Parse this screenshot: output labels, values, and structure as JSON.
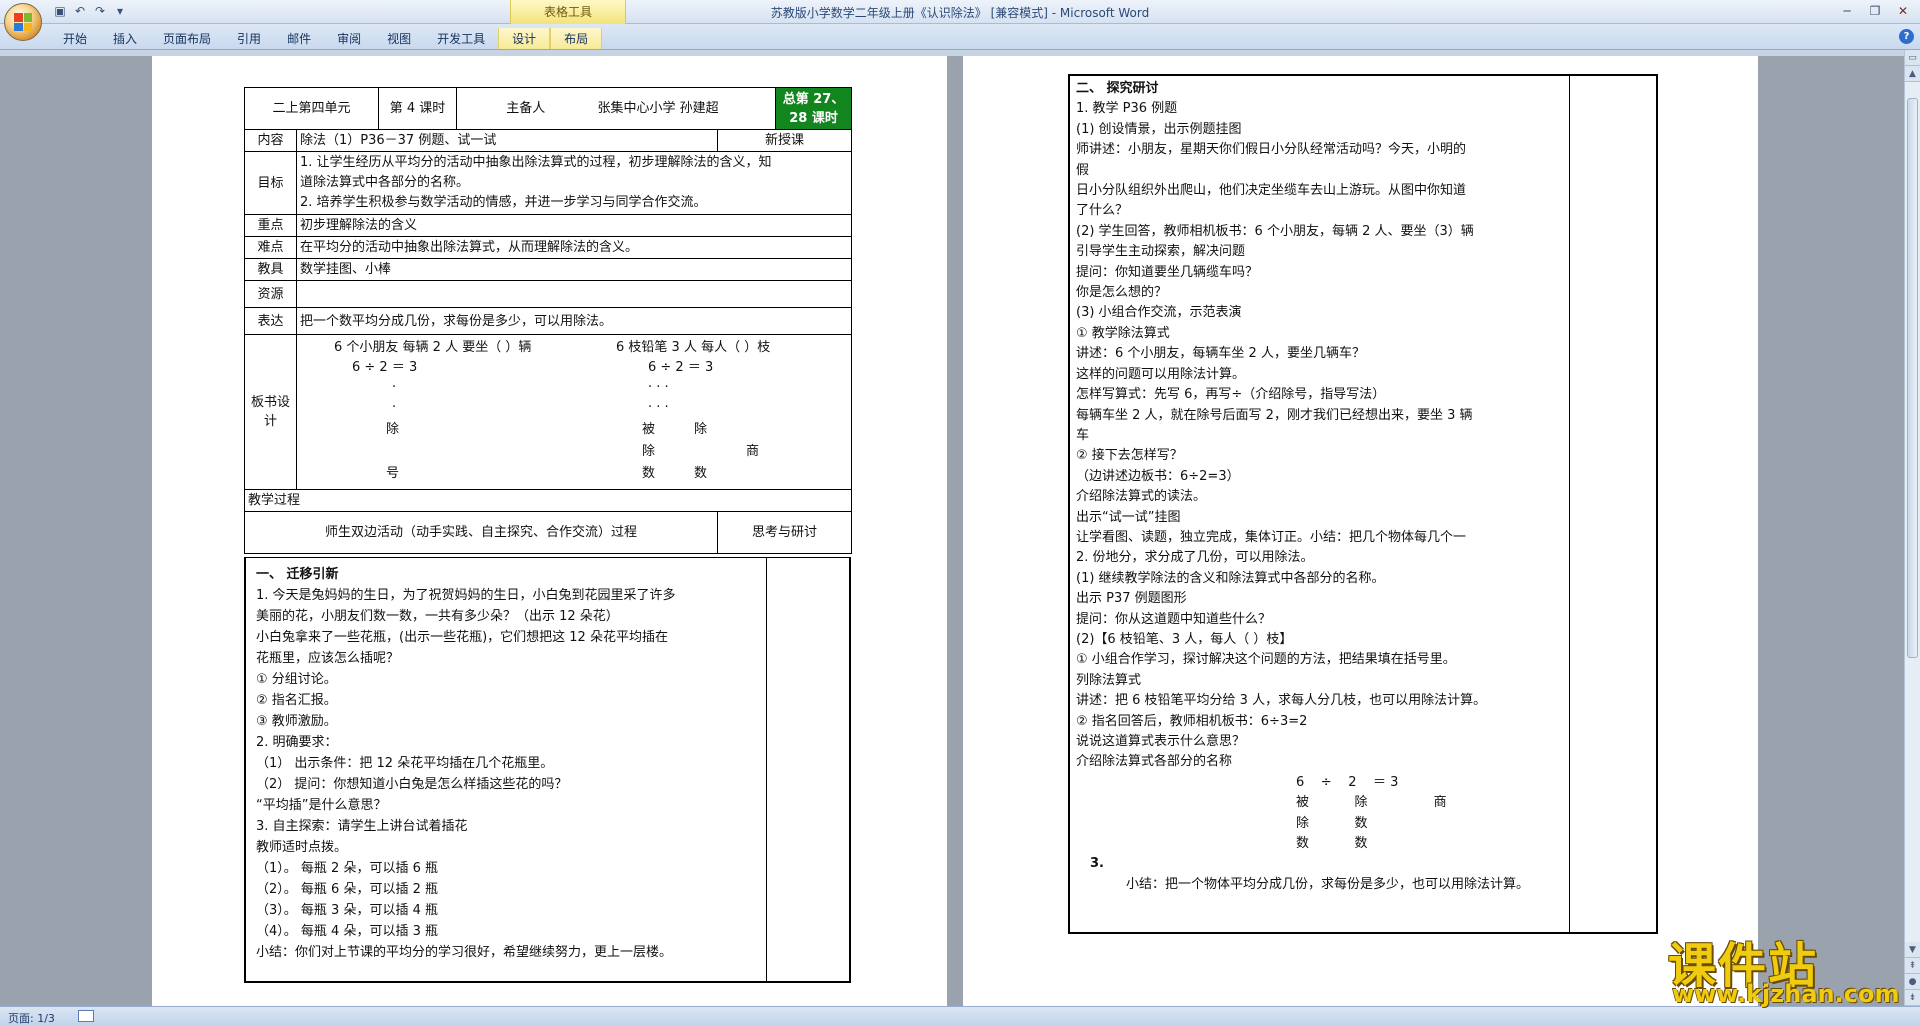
{
  "window": {
    "title": "苏教版小学数学二年级上册《认识除法》 [兼容模式] - Microsoft Word",
    "contextual_group": "表格工具",
    "controls": [
      "minimize",
      "restore",
      "close"
    ]
  },
  "ribbon": {
    "tabs": [
      "开始",
      "插入",
      "页面布局",
      "引用",
      "邮件",
      "审阅",
      "视图",
      "开发工具",
      "设计",
      "布局"
    ]
  },
  "page1": {
    "header": {
      "unit": "二上第四单元",
      "lesson": "第 4 课时",
      "preparer_label": "主备人",
      "preparer": "张集中心小学   孙建超",
      "total": "总第 27、28 课时"
    },
    "content": {
      "label": "内容",
      "value": "除法（1）P36－37 例题、试一试",
      "type": "新授课"
    },
    "goals": {
      "label": "目标",
      "items": [
        "1.   让学生经历从平均分的活动中抽象出除法算式的过程，初步理解除法的含义，知",
        "      道除法算式中各部分的名称。",
        "2.   培养学生积极参与数学活动的情感，并进一步学习与同学合作交流。"
      ]
    },
    "key": {
      "label": "重点",
      "value": "初步理解除法的含义"
    },
    "difficulty": {
      "label": "难点",
      "value": "在平均分的活动中抽象出除法算式，从而理解除法的含义。"
    },
    "tools": {
      "label": "教具",
      "value": "数学挂图、小棒"
    },
    "resources": {
      "label": "资源",
      "value": ""
    },
    "expression": {
      "label": "表达",
      "value": "把一个数平均分成几份，求每份是多少，可以用除法。"
    },
    "board": {
      "label": "板书设计",
      "left_title": "6 个小朋友    每辆 2 人  要坐（  ）辆",
      "left_eq": "6    ÷    2    ＝ 3",
      "left_dot": "·",
      "left_name_1": "除",
      "left_name_2": "号",
      "right_title": "6 枝铅笔    3 人  每人（    ）枝",
      "right_eq": "6    ÷    2    ＝ 3",
      "right_names": [
        "被",
        "除",
        "数",
        "除",
        "数",
        "商"
      ]
    },
    "process": {
      "label": "教学过程",
      "col_main": "师生双边活动（动手实践、自主探究、合作交流）过程",
      "col_side": "思考与研讨",
      "lines": [
        {
          "t": "一、 迁移引新",
          "cls": "b"
        },
        {
          "t": "  1.   今天是兔妈妈的生日，为了祝贺妈妈的生日，小白兔到花园里采了许多",
          "cls": ""
        },
        {
          "t": "         美丽的花，小朋友们数一数，一共有多少朵？（出示 12 朵花）",
          "cls": ""
        },
        {
          "t": "         小白兔拿来了一些花瓶，(出示一些花瓶)，它们想把这 12 朵花平均插在",
          "cls": ""
        },
        {
          "t": "         花瓶里，应该怎么插呢？",
          "cls": ""
        },
        {
          "t": "  ①    分组讨论。",
          "cls": ""
        },
        {
          "t": "  ②    指名汇报。",
          "cls": ""
        },
        {
          "t": "  ③    教师激励。",
          "cls": ""
        },
        {
          "t": "  2.   明确要求：",
          "cls": ""
        },
        {
          "t": "（1） 出示条件：把 12 朵花平均插在几个花瓶里。",
          "cls": ""
        },
        {
          "t": "（2） 提问：你想知道小白兔是怎么样插这些花的吗？",
          "cls": ""
        },
        {
          "t": "         “平均插”是什么意思？",
          "cls": ""
        },
        {
          "t": "  3.   自主探索：请学生上讲台试着插花",
          "cls": ""
        },
        {
          "t": "          教师适时点拨。",
          "cls": ""
        },
        {
          "t": "（1）。 每瓶 2 朵，可以插 6 瓶",
          "cls": ""
        },
        {
          "t": "（2）。 每瓶 6 朵，可以插 2 瓶",
          "cls": ""
        },
        {
          "t": "（3）。 每瓶 3 朵，可以插 4 瓶",
          "cls": ""
        },
        {
          "t": "（4）。 每瓶 4 朵，可以插 3 瓶",
          "cls": ""
        },
        {
          "t": "         小结：你们对上节课的平均分的学习很好，希望继续努力，更上一层楼。",
          "cls": ""
        }
      ]
    }
  },
  "page2": {
    "lines": [
      {
        "t": "二、 探究研讨",
        "cls": "b"
      },
      {
        "t": "  1.  教学 P36 例题",
        "cls": ""
      },
      {
        "t": "(1)  创设情景，出示例题挂图",
        "cls": ""
      },
      {
        "t": "        师讲述：小朋友，星期天你们假日小分队经常活动吗？今天，小明的",
        "cls": ""
      },
      {
        "t": "        假",
        "cls": ""
      },
      {
        "t": "        日小分队组织外出爬山，他们决定坐缆车去山上游玩。从图中你知道",
        "cls": ""
      },
      {
        "t": "        了什么？",
        "cls": ""
      },
      {
        "t": "(2)  学生回答，教师相机板书：6 个小朋友，每辆 2 人、要坐（3）辆",
        "cls": ""
      },
      {
        "t": "        引导学生主动探索，解决问题",
        "cls": ""
      },
      {
        "t": "        提问：你知道要坐几辆缆车吗？",
        "cls": ""
      },
      {
        "t": "        你是怎么想的？",
        "cls": ""
      },
      {
        "t": "(3)  小组合作交流，示范表演",
        "cls": ""
      },
      {
        "t": "   ①  教学除法算式",
        "cls": ""
      },
      {
        "t": "        讲述：6 个小朋友，每辆车坐 2 人，要坐几辆车？",
        "cls": ""
      },
      {
        "t": "        这样的问题可以用除法计算。",
        "cls": ""
      },
      {
        "t": "        怎样写算式：先写 6，再写÷（介绍除号，指导写法）",
        "cls": ""
      },
      {
        "t": "        每辆车坐 2 人，就在除号后面写 2，刚才我们已经想出来，要坐 3 辆",
        "cls": ""
      },
      {
        "t": "        车",
        "cls": ""
      },
      {
        "t": "   ②  接下去怎样写？",
        "cls": ""
      },
      {
        "t": "        （边讲述边板书：6÷2=3）",
        "cls": ""
      },
      {
        "t": "        介绍除法算式的读法。",
        "cls": ""
      },
      {
        "t": "        出示“试一试”挂图",
        "cls": ""
      },
      {
        "t": "        让学看图、读题，独立完成，集体订正。小结：把几个物体每几个一",
        "cls": ""
      },
      {
        "t": "  2.  份地分，求分成了几份，可以用除法。",
        "cls": ""
      },
      {
        "t": "(1)  继续教学除法的含义和除法算式中各部分的名称。",
        "cls": ""
      },
      {
        "t": "        出示 P37 例题图形",
        "cls": ""
      },
      {
        "t": "         提问：你从这道题中知道些什么？",
        "cls": ""
      },
      {
        "t": "(2)【6 枝铅笔、3 人，每人（   ）枝】",
        "cls": ""
      },
      {
        "t": "   ①  小组合作学习，探讨解决这个问题的方法，把结果填在括号里。",
        "cls": ""
      },
      {
        "t": "        列除法算式",
        "cls": ""
      },
      {
        "t": "        讲述：把 6 枝铅笔平均分给 3 人，求每人分几枝，也可以用除法计算。",
        "cls": ""
      },
      {
        "t": "   ②  指名回答后，教师相机板书：6÷3=2",
        "cls": ""
      },
      {
        "t": "        说说这道算式表示什么意思？",
        "cls": ""
      },
      {
        "t": "        介绍除法算式各部分的名称",
        "cls": ""
      }
    ],
    "eq_line": "6    ÷    2    ＝ 3",
    "name_row_1": "被           除                商",
    "name_row_2": "除           数",
    "name_row_3": "数           数",
    "step3": "3.",
    "summary": "小结：把一个物体平均分成几份，求每份是多少，也可以用除法计算。"
  },
  "statusbar": {
    "page": "页面: 1/3"
  },
  "watermark": {
    "cn": "课件站",
    "url": "www.kjzhan.com"
  }
}
